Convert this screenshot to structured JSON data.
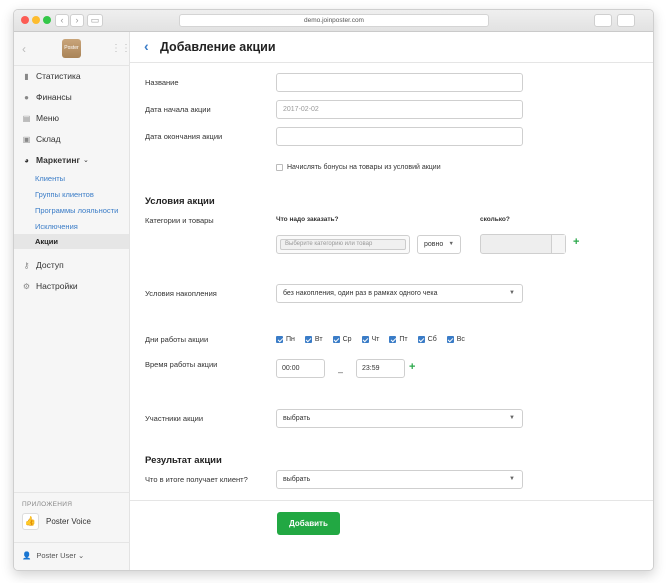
{
  "browser": {
    "url": "demo.joinposter.com"
  },
  "sidebar": {
    "logo_text": "Poster",
    "menu": [
      {
        "label": "Статистика",
        "icon": "bar-chart-icon"
      },
      {
        "label": "Финансы",
        "icon": "coin-icon"
      },
      {
        "label": "Меню",
        "icon": "document-icon"
      },
      {
        "label": "Склад",
        "icon": "box-icon"
      },
      {
        "label": "Маркетинг",
        "icon": "pie-chart-icon"
      }
    ],
    "marketing_caret": "⌄",
    "submenu": [
      "Клиенты",
      "Группы клиентов",
      "Программы лояльности",
      "Исключения",
      "Акции"
    ],
    "menu_bottom": [
      {
        "label": "Доступ",
        "icon": "key-icon"
      },
      {
        "label": "Настройки",
        "icon": "gear-icon"
      }
    ],
    "apps_label": "ПРИЛОЖЕНИЯ",
    "app_name": "Poster Voice",
    "user_name": "Poster User ⌄"
  },
  "page": {
    "title": "Добавление акции",
    "fields": {
      "name_label": "Название",
      "name_value": "",
      "start_label": "Дата начала акции",
      "start_placeholder": "2017-02-02",
      "end_label": "Дата окончания акции",
      "end_value": "",
      "bonus_label": "Начислять бонусы на товары из условий акции"
    },
    "conditions": {
      "title": "Условия акции",
      "categories_label": "Категории и товары",
      "what_head": "Что надо заказать?",
      "how_many_head": "сколько?",
      "category_placeholder": "Выберите категорию или товар",
      "equality": "ровно",
      "accumulation_label": "Условия накопления",
      "accumulation_value": "без накопления, один раз в рамках одного чека",
      "days_label": "Дни работы акции",
      "days": [
        "Пн",
        "Вт",
        "Ср",
        "Чт",
        "Пт",
        "Сб",
        "Вс"
      ],
      "time_label": "Время работы акции",
      "time_from": "00:00",
      "time_dash": "–",
      "time_to": "23:59",
      "participants_label": "Участники акции",
      "participants_value": "выбрать"
    },
    "result": {
      "title": "Результат акции",
      "client_gets_label": "Что в итоге получает клиент?",
      "client_gets_value": "выбрать"
    },
    "submit_label": "Добавить"
  }
}
